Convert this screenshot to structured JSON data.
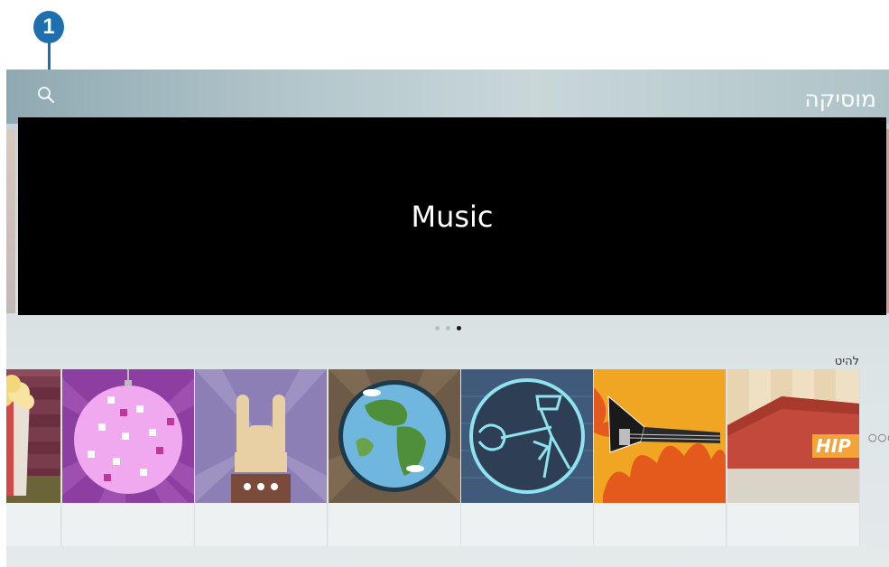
{
  "annotation": {
    "callout_number": "1"
  },
  "header": {
    "title": "מוסיקה",
    "search_icon": "search-icon"
  },
  "banner": {
    "text": "Music",
    "page_count": 3,
    "active_page": 3
  },
  "section": {
    "label": "להיט",
    "cards": [
      {
        "name": "popcorn-theater",
        "icon": "popcorn-icon"
      },
      {
        "name": "disco-ball",
        "icon": "disco-ball-icon"
      },
      {
        "name": "rock-hand",
        "icon": "rock-hand-icon"
      },
      {
        "name": "globe",
        "icon": "globe-icon"
      },
      {
        "name": "jazz-guitarist",
        "icon": "guitarist-icon"
      },
      {
        "name": "flaming-guitar",
        "icon": "electric-guitar-icon"
      },
      {
        "name": "hip-hop-tent",
        "icon": "hip-tent-icon",
        "text": "HIP"
      }
    ],
    "more_icon": "more-icon"
  }
}
